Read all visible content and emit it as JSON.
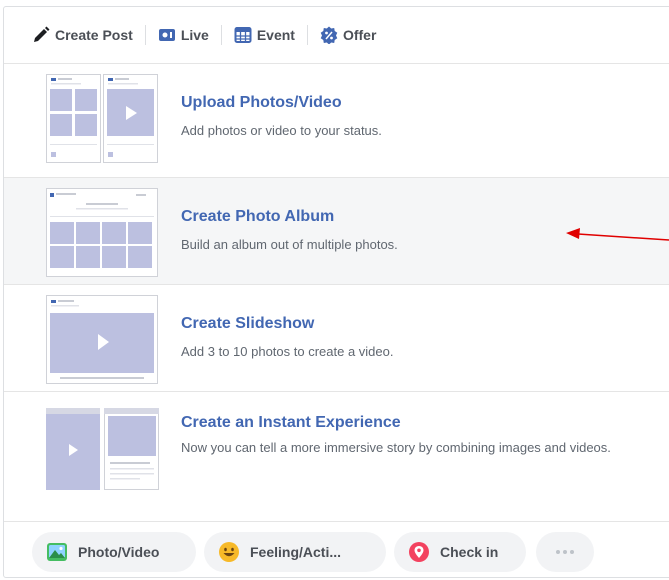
{
  "topbar": {
    "tabs": [
      {
        "label": "Create Post",
        "icon": "pencil-icon"
      },
      {
        "label": "Live",
        "icon": "live-video-icon"
      },
      {
        "label": "Event",
        "icon": "calendar-icon"
      },
      {
        "label": "Offer",
        "icon": "offer-badge-icon"
      }
    ]
  },
  "options": [
    {
      "title": "Upload Photos/Video",
      "desc": "Add photos or video to your status."
    },
    {
      "title": "Create Photo Album",
      "desc": "Build an album out of multiple photos."
    },
    {
      "title": "Create Slideshow",
      "desc": "Add 3 to 10 photos to create a video."
    },
    {
      "title": "Create an Instant Experience",
      "desc": "Now you can tell a more immersive story by combining images and videos."
    }
  ],
  "bottombar": {
    "actions": [
      {
        "label": "Photo/Video",
        "icon": "photo-icon"
      },
      {
        "label": "Feeling/Acti...",
        "icon": "smiley-icon"
      },
      {
        "label": "Check in",
        "icon": "location-pin-icon"
      },
      {
        "label": "",
        "icon": "more-dots-icon"
      }
    ]
  },
  "colors": {
    "link_blue": "#4267b2",
    "annotation_red": "#e00000",
    "placeholder": "#bcc0e0"
  }
}
